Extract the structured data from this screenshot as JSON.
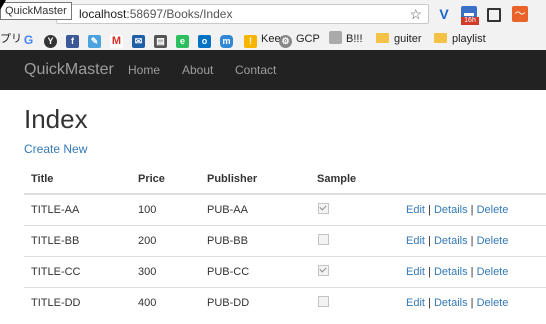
{
  "browser": {
    "tooltip": "QuickMaster",
    "url_host": "localhost",
    "url_path": ":58697/Books/Index",
    "cal_badge": "16h",
    "bookmarks": {
      "apps": "プリ",
      "keep": "Keep",
      "gcp": "GCP",
      "bmark": "B!!!",
      "guiter": "guiter",
      "playlist": "playlist"
    }
  },
  "navbar": {
    "brand": "QuickMaster",
    "links": [
      "Home",
      "About",
      "Contact"
    ]
  },
  "page": {
    "title": "Index",
    "create_link": "Create New"
  },
  "table": {
    "headers": [
      "Title",
      "Price",
      "Publisher",
      "Sample"
    ],
    "rows": [
      {
        "title": "TITLE-AA",
        "price": "100",
        "publisher": "PUB-AA",
        "sample": true
      },
      {
        "title": "TITLE-BB",
        "price": "200",
        "publisher": "PUB-BB",
        "sample": false
      },
      {
        "title": "TITLE-CC",
        "price": "300",
        "publisher": "PUB-CC",
        "sample": true
      },
      {
        "title": "TITLE-DD",
        "price": "400",
        "publisher": "PUB-DD",
        "sample": false
      }
    ],
    "actions": {
      "edit": "Edit",
      "details": "Details",
      "delete": "Delete",
      "separator": "|"
    }
  },
  "colors": {
    "navbar_bg": "#222222",
    "link": "#337ab7",
    "nav_text": "#9d9d9d"
  }
}
